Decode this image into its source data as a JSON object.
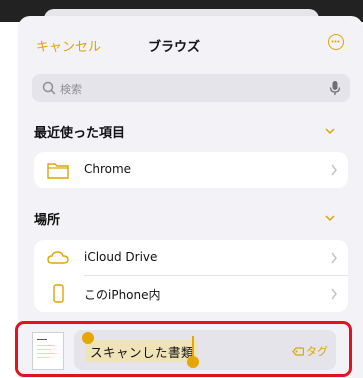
{
  "header": {
    "cancel_label": "キャンセル",
    "title": "ブラウズ",
    "more_icon": "ellipsis-circle-icon"
  },
  "search": {
    "placeholder": "検索",
    "icon": "search-icon",
    "mic_icon": "microphone-icon"
  },
  "recents": {
    "title": "最近使った項目",
    "items": [
      {
        "label": "Chrome",
        "icon": "folder-icon"
      }
    ]
  },
  "locations": {
    "title": "場所",
    "items": [
      {
        "label": "iCloud Drive",
        "icon": "cloud-icon"
      },
      {
        "label": "このiPhone内",
        "icon": "iphone-icon"
      }
    ]
  },
  "save_bar": {
    "filename": "スキャンした書類",
    "tag_label": "タグ",
    "tag_icon": "tag-icon"
  },
  "colors": {
    "accent": "#e0a400",
    "highlight_border": "#e0141e",
    "background": "#f2f2f7"
  }
}
